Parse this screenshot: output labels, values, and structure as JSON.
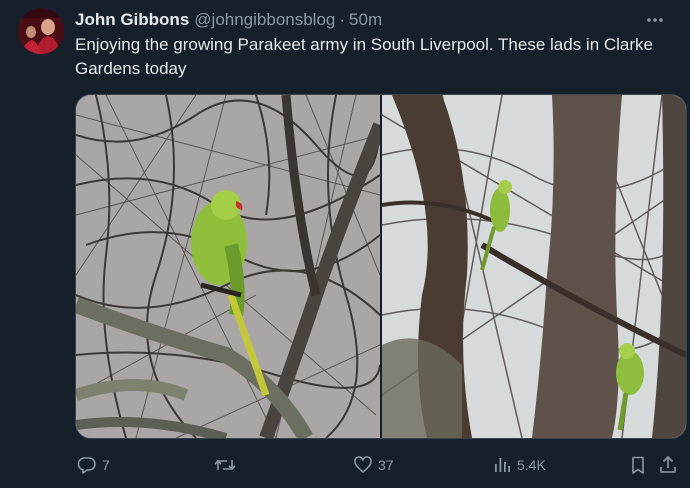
{
  "tweet": {
    "author_name": "John Gibbons",
    "handle": "@johngibbonsblog",
    "separator": "·",
    "time": "50m",
    "text": "Enjoying the growing Parakeet army in South Liverpool. These lads in Clarke Gardens today",
    "reply_count": "7",
    "retweet_count": "",
    "like_count": "37",
    "view_count": "5.4K"
  },
  "icons": {
    "more": "more-horizontal-icon",
    "reply": "reply-icon",
    "retweet": "retweet-icon",
    "like": "heart-icon",
    "views": "analytics-icon",
    "bookmark": "bookmark-icon",
    "share": "share-icon"
  },
  "colors": {
    "background": "#15202b",
    "text_primary": "#e7e9ea",
    "text_secondary": "#8b98a5",
    "border": "#38444d"
  }
}
